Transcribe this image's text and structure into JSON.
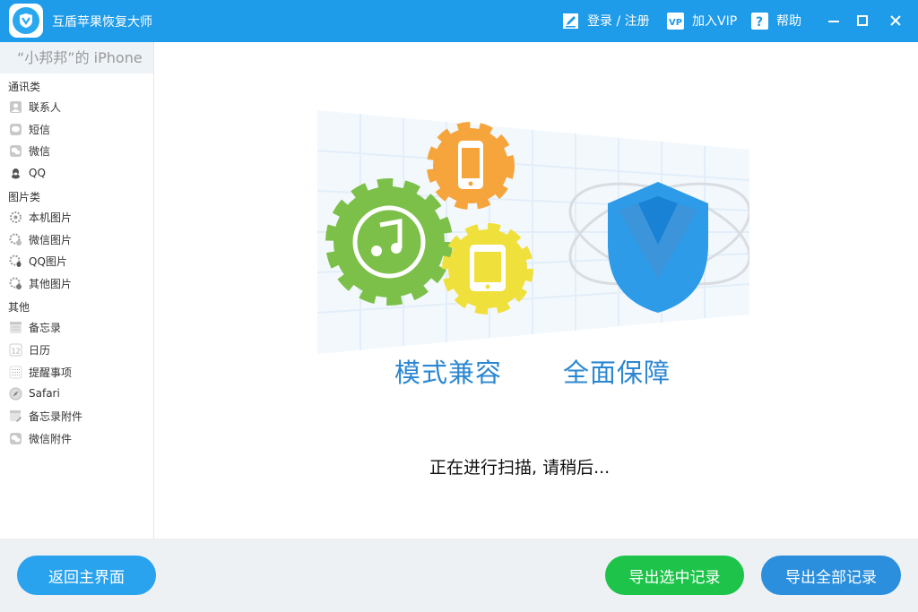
{
  "titlebar": {
    "app_title": "互盾苹果恢复大师",
    "login_label": "登录 / 注册",
    "vip_label": "加入VIP",
    "help_label": "帮助",
    "color": "#1e9be9"
  },
  "sidebar": {
    "device_name": "“小邦邦”的 iPhone",
    "categories": {
      "communication": "通讯类",
      "images": "图片类",
      "other": "其他"
    },
    "items": [
      {
        "label": "联系人",
        "icon": "contacts-icon"
      },
      {
        "label": "短信",
        "icon": "sms-icon"
      },
      {
        "label": "微信",
        "icon": "wechat-icon"
      },
      {
        "label": "QQ",
        "icon": "qq-icon"
      },
      {
        "label": "本机图片",
        "icon": "local-photo-icon"
      },
      {
        "label": "微信图片",
        "icon": "wechat-photo-icon"
      },
      {
        "label": "QQ图片",
        "icon": "qq-photo-icon"
      },
      {
        "label": "其他图片",
        "icon": "other-photo-icon"
      },
      {
        "label": "备忘录",
        "icon": "notes-icon"
      },
      {
        "label": "日历",
        "icon": "calendar-icon"
      },
      {
        "label": "提醒事项",
        "icon": "reminders-icon"
      },
      {
        "label": "Safari",
        "icon": "safari-icon"
      },
      {
        "label": "备忘录附件",
        "icon": "notes-attachment-icon"
      },
      {
        "label": "微信附件",
        "icon": "wechat-attachment-icon"
      }
    ]
  },
  "main": {
    "slogan_left": "模式兼容",
    "slogan_right": "全面保障",
    "scan_status": "正在进行扫描, 请稍后..."
  },
  "bottom": {
    "back_label": "返回主界面",
    "export_selected_label": "导出选中记录",
    "export_all_label": "导出全部记录",
    "green": "#1ec44a",
    "blue": "#2b8fdd"
  }
}
